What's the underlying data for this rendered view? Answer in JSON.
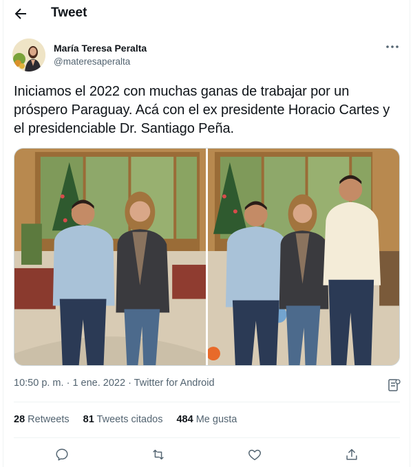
{
  "header": {
    "back_icon": "arrow-left-icon",
    "title": "Tweet"
  },
  "author": {
    "name": "María Teresa Peralta",
    "handle": "@materesaperalta",
    "more_icon": "more-horizontal-icon"
  },
  "tweet": {
    "text": "Iniciamos el 2022 con muchas ganas de trabajar por un próspero Paraguay. Acá con el ex presidente Horacio Cartes y el presidenciable Dr. Santiago Peña.",
    "photos": [
      "photo-1",
      "photo-2"
    ]
  },
  "meta": {
    "time": "10:50 p. m.",
    "separator1": " · ",
    "date": "1 ene. 2022",
    "separator2": " · ",
    "source": "Twitter for Android",
    "analytics_icon": "analytics-icon"
  },
  "stats": {
    "retweets_count": "28",
    "retweets_label": "Retweets",
    "quotes_count": "81",
    "quotes_label": "Tweets citados",
    "likes_count": "484",
    "likes_label": "Me gusta"
  },
  "actions": {
    "reply_icon": "reply-icon",
    "retweet_icon": "retweet-icon",
    "like_icon": "heart-icon",
    "share_icon": "share-icon"
  },
  "colors": {
    "text": "#0f1419",
    "secondary": "#536471",
    "border": "#eff3f4"
  }
}
